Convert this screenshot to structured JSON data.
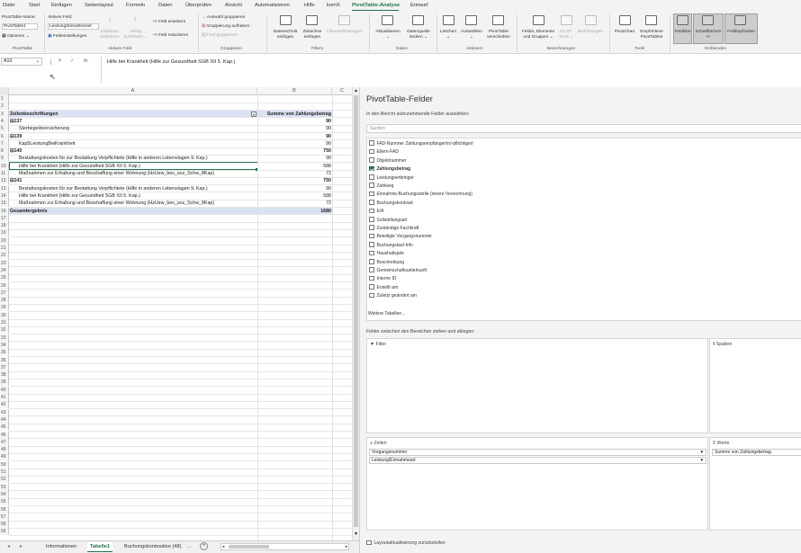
{
  "menu": {
    "items": [
      "Datei",
      "Start",
      "Einfügen",
      "Seitenlayout",
      "Formeln",
      "Daten",
      "Überprüfen",
      "Ansicht",
      "Automatisieren",
      "Hilfe",
      "komX",
      "PivotTable-Analyse",
      "Entwurf"
    ],
    "active_index": 11
  },
  "ribbon": {
    "pivottable": {
      "name_label": "PivotTable-Name:",
      "name_value": "PivotTable1",
      "options": "Optionen",
      "group": "PivotTable"
    },
    "active_field": {
      "label": "Aktives Feld:",
      "value": "Leistung/Einnahmeart",
      "settings": "Feldeinstellungen",
      "drilldown": "Drilldown",
      "drilldown2": "ausführen",
      "drillup": "Drillup",
      "drillup2": "ausführen",
      "expand": "Feld erweitern",
      "collapse": "Feld reduzieren",
      "group": "Aktives Feld"
    },
    "grouping": {
      "sel": "Auswahl gruppieren",
      "ungroup": "Gruppierung aufheben",
      "field": "Feld gruppieren",
      "group": "Gruppieren"
    },
    "filter": {
      "slicer": "Datenschnitt",
      "slicer2": "einfügen",
      "timeline": "Zeitachse",
      "timeline2": "einfügen",
      "connections": "Filterverbindungen",
      "group": "Filtern"
    },
    "data": {
      "refresh": "Aktualisieren",
      "source": "Datenquelle",
      "source2": "ändern",
      "group": "Daten"
    },
    "actions": {
      "clear": "Löschen",
      "select": "Auswählen",
      "move": "PivotTable",
      "move2": "verschieben",
      "group": "Aktionen"
    },
    "calc": {
      "fields": "Felder, Elemente",
      "fields2": "und Gruppen",
      "olap": "OLAP-",
      "olap2": "Tools",
      "rel": "Beziehungen",
      "group": "Berechnungen"
    },
    "tools": {
      "chart": "PivotChart",
      "rec": "Empfohlene",
      "rec2": "PivotTables",
      "group": "Tools"
    },
    "show": {
      "list": "Feldliste",
      "buttons": "Schaltflächen",
      "buttons2": "+/-",
      "headers": "Feldkopfzeilen",
      "group": "Einblenden"
    }
  },
  "formula_bar": {
    "name_box": "A10",
    "fx": "fx",
    "content": "Hilfe bei Krankheit (Hilfe zur Gesundheit SGB XII 5. Kap.)"
  },
  "sheet": {
    "columns": [
      "A",
      "B",
      "C"
    ],
    "rows": [
      {
        "n": "1",
        "a": "",
        "b": ""
      },
      {
        "n": "2",
        "a": "",
        "b": ""
      },
      {
        "n": "3",
        "a": "Zeilenbeschriftungen",
        "b": "Summe von Zahlungsbetrag",
        "style": "hdr"
      },
      {
        "n": "4",
        "a": "⊟137",
        "b": "90",
        "style": "bold"
      },
      {
        "n": "5",
        "a": "Sterbegeldversicherung",
        "b": "90",
        "indent": 2
      },
      {
        "n": "6",
        "a": "⊟139",
        "b": "90",
        "style": "bold"
      },
      {
        "n": "7",
        "a": "Kap5LeistungBeiKrankheit",
        "b": "90",
        "indent": 2
      },
      {
        "n": "8",
        "a": "⊟140",
        "b": "750",
        "style": "bold"
      },
      {
        "n": "9",
        "a": "Bestattungskosten für zur Bestattung Verpflichtete (Hilfe in anderen Lebenslagen 9. Kap.)",
        "b": "90",
        "indent": 2
      },
      {
        "n": "10",
        "a": "Hilfe bei Krankheit (Hilfe zur Gesundheit SGB XII 5. Kap.)",
        "b": "588",
        "indent": 2,
        "active": true
      },
      {
        "n": "11",
        "a": "Maßnahmen zur Erhaltung und Beschaffung einer Wohnung (HzUew_bes_soz_Schw_8Kap)",
        "b": "72",
        "indent": 2
      },
      {
        "n": "12",
        "a": "⊟141",
        "b": "750",
        "style": "bold"
      },
      {
        "n": "13",
        "a": "Bestattungskosten für zur Bestattung Verpflichtete (Hilfe in anderen Lebenslagen 9. Kap.)",
        "b": "90",
        "indent": 2
      },
      {
        "n": "14",
        "a": "Hilfe bei Krankheit (Hilfe zur Gesundheit SGB XII 5. Kap.)",
        "b": "588",
        "indent": 2
      },
      {
        "n": "15",
        "a": "Maßnahmen zur Erhaltung und Beschaffung einer Wohnung (HzUew_bes_soz_Schw_8Kap)",
        "b": "72",
        "indent": 2
      },
      {
        "n": "16",
        "a": "Gesamtergebnis",
        "b": "1680",
        "style": "tot"
      }
    ],
    "empty_row_numbers": [
      "17",
      "18",
      "19",
      "20",
      "21",
      "22",
      "23",
      "24",
      "25",
      "26",
      "27",
      "28",
      "29",
      "30",
      "31",
      "32",
      "33",
      "34",
      "35",
      "36",
      "37",
      "38",
      "39",
      "40",
      "41",
      "42",
      "43",
      "44",
      "45",
      "46",
      "47",
      "48",
      "49",
      "50",
      "51",
      "52",
      "53",
      "54",
      "55",
      "56",
      "57",
      "58",
      "59"
    ]
  },
  "tabs": {
    "items": [
      "Informationen",
      "Tabelle1",
      "Buchungskontosätze (48)",
      "..."
    ],
    "active_index": 1
  },
  "pane": {
    "title": "PivotTable-Felder",
    "subtitle": "In den Bericht aufzunehmende Felder auswählen:",
    "search_placeholder": "Suchen",
    "fields": [
      {
        "label": "FAD-Nummer Zahlungsempfänger/in/-pflichtige/r",
        "checked": false
      },
      {
        "label": "Eltern-FAD",
        "checked": false
      },
      {
        "label": "Objektnummer",
        "checked": false
      },
      {
        "label": "Zahlungsbetrag",
        "checked": true
      },
      {
        "label": "Leistungserbringer",
        "checked": false
      },
      {
        "label": "Zahlweg",
        "checked": false
      },
      {
        "label": "Einnahme-Buchungsstelle (innere Verrechnung)",
        "checked": false
      },
      {
        "label": "Buchungskontoart",
        "checked": false
      },
      {
        "label": "E/A",
        "checked": false
      },
      {
        "label": "Sollstellungsart",
        "checked": false
      },
      {
        "label": "Zuständige Fachkraft",
        "checked": false
      },
      {
        "label": "Beteiligte Vorgangsnummer",
        "checked": false
      },
      {
        "label": "Buchungslauf-Info",
        "checked": false
      },
      {
        "label": "Haushaltsjahr",
        "checked": false
      },
      {
        "label": "Beschreibung",
        "checked": false
      },
      {
        "label": "Gemeinschaftsunterkunft",
        "checked": false
      },
      {
        "label": "Interne ID",
        "checked": false
      },
      {
        "label": "Erstellt am",
        "checked": false
      },
      {
        "label": "Zuletzt geändert am",
        "checked": false
      }
    ],
    "more_tables": "Weitere Tabellen...",
    "drag_hint": "Felder zwischen den Bereichen ziehen und ablegen:",
    "filter_label": "Filter",
    "columns_label": "Spalten",
    "rows_label": "Zeilen",
    "values_label": "Werte",
    "row_items": [
      "Vorgangsnummer",
      "Leistung/Einnahmeart"
    ],
    "value_items": [
      "Summe von Zahlungsbetrag"
    ],
    "defer": "Layoutaktualisierung zurückstellen"
  },
  "colors": {
    "accent": "#217346",
    "pivot_header": "#d9e1f2"
  }
}
